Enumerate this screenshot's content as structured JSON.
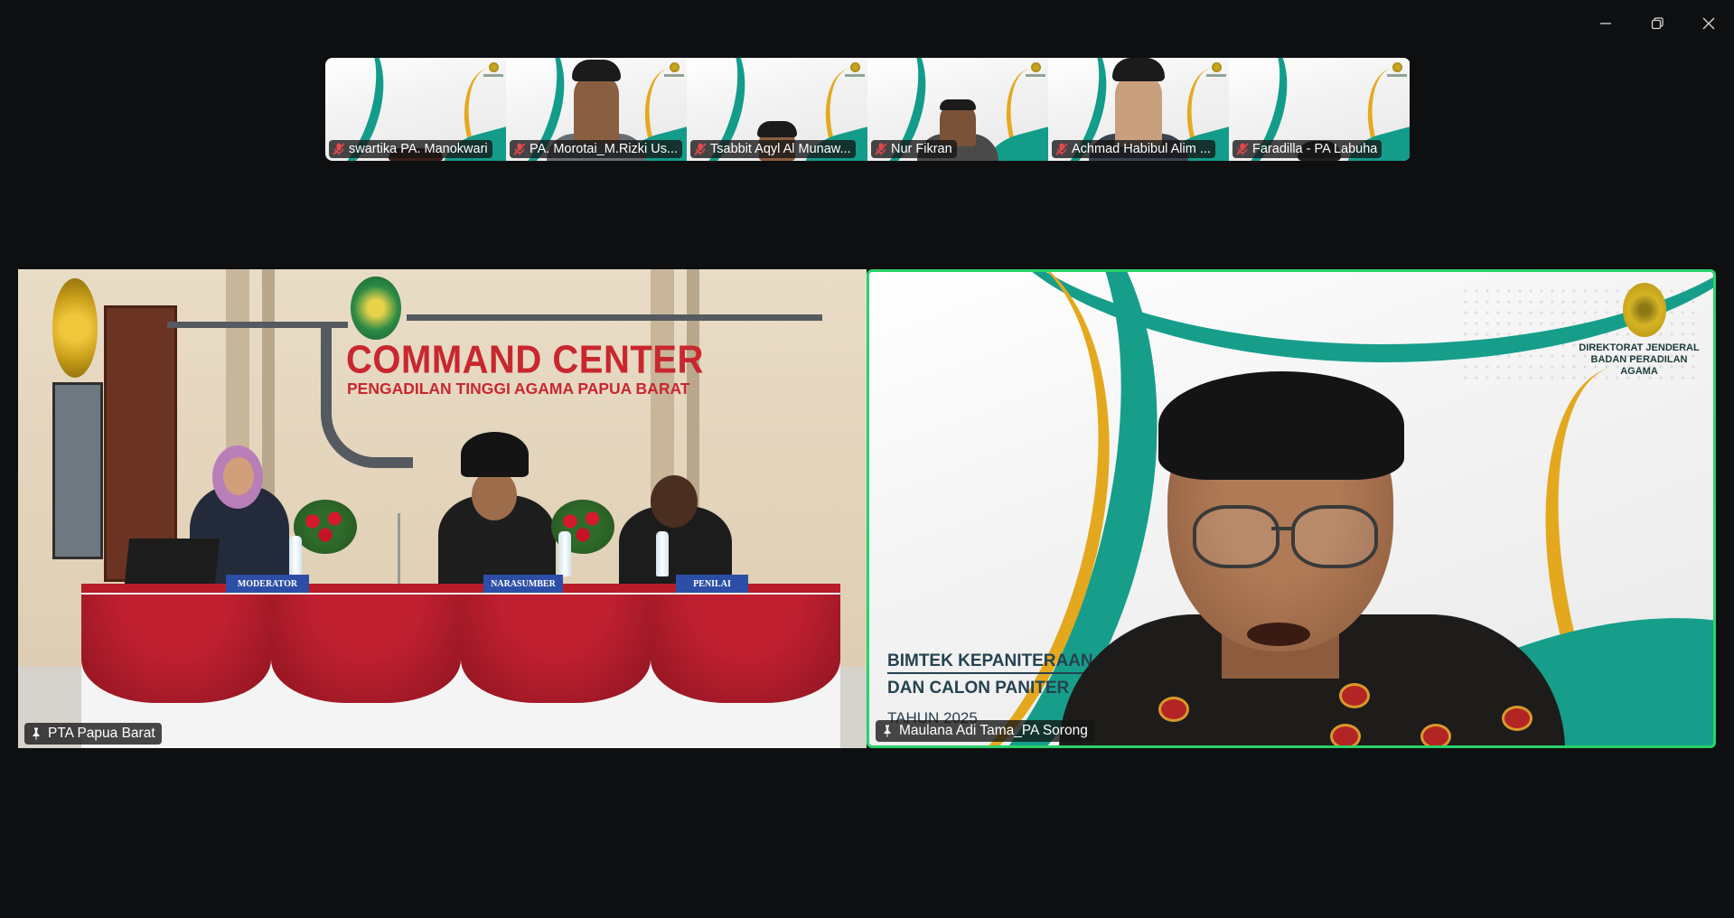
{
  "window": {
    "controls": {
      "minimize_icon": "minimize-icon",
      "restore_icon": "restore-icon",
      "close_icon": "close-icon"
    }
  },
  "thumbnails": [
    {
      "name": "swartika PA. Manokwari",
      "muted": true
    },
    {
      "name": "PA. Morotai_M.Rizki Us...",
      "muted": true
    },
    {
      "name": "Tsabbit Aqyl Al Munaw...",
      "muted": true
    },
    {
      "name": "Nur Fikran",
      "muted": true
    },
    {
      "name": "Achmad Habibul Alim ...",
      "muted": true
    },
    {
      "name": "Faradilla - PA Labuha",
      "muted": true
    }
  ],
  "main_tiles": {
    "left": {
      "name": "PTA Papua Barat",
      "pinned": true,
      "scene": {
        "title": "COMMAND CENTER",
        "subtitle": "PENGADILAN TINGGI AGAMA PAPUA BARAT",
        "nameplates": [
          "MODERATOR",
          "NARASUMBER",
          "PENILAI"
        ]
      }
    },
    "right": {
      "name": "Maulana Adi Tama_PA Sorong",
      "pinned": true,
      "active_speaker": true,
      "highlight_color": "#2ad16a",
      "scene": {
        "org_line1": "DIREKTORAT JENDERAL",
        "org_line2": "BADAN PERADILAN AGAMA",
        "slide_line1": "BIMTEK KEPANITERAAN",
        "slide_line2": "DAN CALON PANITER",
        "slide_line3": "TAHUN 2025"
      }
    }
  },
  "colors": {
    "background": "#0e0f11",
    "muted_mic": "#e5484d",
    "teal": "#169e8b",
    "gold": "#e4a81e"
  }
}
